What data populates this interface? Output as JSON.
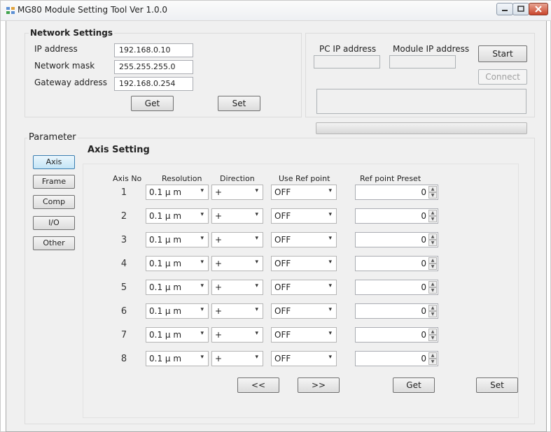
{
  "window": {
    "title": "MG80 Module Setting Tool Ver 1.0.0"
  },
  "network": {
    "title": "Network Settings",
    "ip_label": "IP address",
    "ip_value": "192.168.0.10",
    "mask_label": "Network mask",
    "mask_value": "255.255.255.0",
    "gateway_label": "Gateway address",
    "gateway_value": "192.168.0.254",
    "get_label": "Get",
    "set_label": "Set"
  },
  "connection": {
    "pc_ip_label": "PC IP address",
    "pc_ip_value": "",
    "module_ip_label": "Module IP address",
    "module_ip_value": "",
    "start_label": "Start",
    "connect_label": "Connect",
    "message": "",
    "progress": 0
  },
  "parameter": {
    "title": "Parameter",
    "tabs": [
      {
        "label": "Axis"
      },
      {
        "label": "Frame"
      },
      {
        "label": "Comp"
      },
      {
        "label": "I/O"
      },
      {
        "label": "Other"
      }
    ],
    "active_tab": "Axis"
  },
  "axis": {
    "title": "Axis Setting",
    "headers": {
      "axis_no": "Axis No",
      "resolution": "Resolution",
      "direction": "Direction",
      "use_ref": "Use Ref point",
      "ref_preset": "Ref point Preset"
    },
    "rows": [
      {
        "no": "1",
        "resolution": "0.1 µ m",
        "direction": "+",
        "use_ref": "OFF",
        "preset": "0"
      },
      {
        "no": "2",
        "resolution": "0.1 µ m",
        "direction": "+",
        "use_ref": "OFF",
        "preset": "0"
      },
      {
        "no": "3",
        "resolution": "0.1 µ m",
        "direction": "+",
        "use_ref": "OFF",
        "preset": "0"
      },
      {
        "no": "4",
        "resolution": "0.1 µ m",
        "direction": "+",
        "use_ref": "OFF",
        "preset": "0"
      },
      {
        "no": "5",
        "resolution": "0.1 µ m",
        "direction": "+",
        "use_ref": "OFF",
        "preset": "0"
      },
      {
        "no": "6",
        "resolution": "0.1 µ m",
        "direction": "+",
        "use_ref": "OFF",
        "preset": "0"
      },
      {
        "no": "7",
        "resolution": "0.1 µ m",
        "direction": "+",
        "use_ref": "OFF",
        "preset": "0"
      },
      {
        "no": "8",
        "resolution": "0.1 µ m",
        "direction": "+",
        "use_ref": "OFF",
        "preset": "0"
      }
    ],
    "prev_label": "<<",
    "next_label": ">>",
    "get_label": "Get",
    "set_label": "Set"
  },
  "icons": {
    "dropdown": "▾",
    "spin_up": "▲",
    "spin_down": "▼"
  },
  "colors": {
    "window_bg": "#f0f0f0",
    "active_tab": "#c4e5f6",
    "close_button": "#c9452c"
  }
}
